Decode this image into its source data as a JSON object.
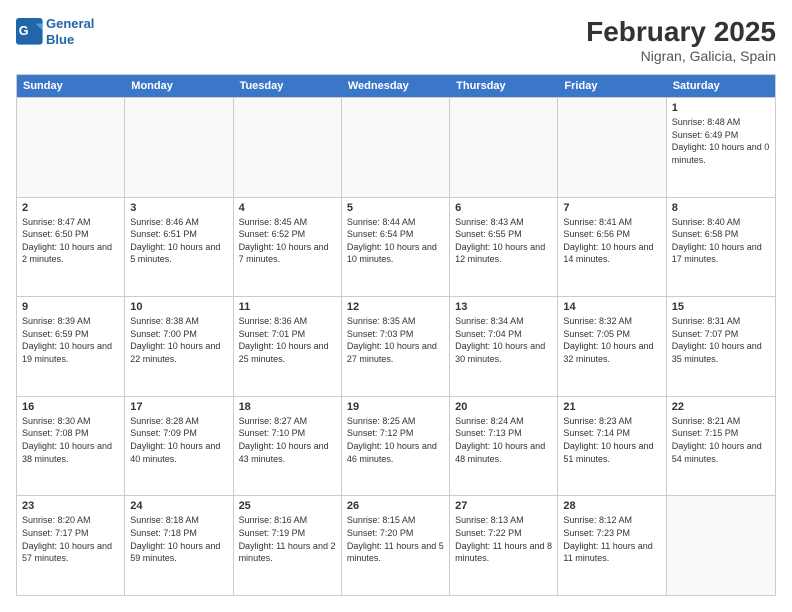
{
  "header": {
    "logo_general": "General",
    "logo_blue": "Blue",
    "title": "February 2025",
    "subtitle": "Nigran, Galicia, Spain"
  },
  "weekdays": [
    "Sunday",
    "Monday",
    "Tuesday",
    "Wednesday",
    "Thursday",
    "Friday",
    "Saturday"
  ],
  "rows": [
    [
      {
        "day": "",
        "text": ""
      },
      {
        "day": "",
        "text": ""
      },
      {
        "day": "",
        "text": ""
      },
      {
        "day": "",
        "text": ""
      },
      {
        "day": "",
        "text": ""
      },
      {
        "day": "",
        "text": ""
      },
      {
        "day": "1",
        "text": "Sunrise: 8:48 AM\nSunset: 6:49 PM\nDaylight: 10 hours and 0 minutes."
      }
    ],
    [
      {
        "day": "2",
        "text": "Sunrise: 8:47 AM\nSunset: 6:50 PM\nDaylight: 10 hours and 2 minutes."
      },
      {
        "day": "3",
        "text": "Sunrise: 8:46 AM\nSunset: 6:51 PM\nDaylight: 10 hours and 5 minutes."
      },
      {
        "day": "4",
        "text": "Sunrise: 8:45 AM\nSunset: 6:52 PM\nDaylight: 10 hours and 7 minutes."
      },
      {
        "day": "5",
        "text": "Sunrise: 8:44 AM\nSunset: 6:54 PM\nDaylight: 10 hours and 10 minutes."
      },
      {
        "day": "6",
        "text": "Sunrise: 8:43 AM\nSunset: 6:55 PM\nDaylight: 10 hours and 12 minutes."
      },
      {
        "day": "7",
        "text": "Sunrise: 8:41 AM\nSunset: 6:56 PM\nDaylight: 10 hours and 14 minutes."
      },
      {
        "day": "8",
        "text": "Sunrise: 8:40 AM\nSunset: 6:58 PM\nDaylight: 10 hours and 17 minutes."
      }
    ],
    [
      {
        "day": "9",
        "text": "Sunrise: 8:39 AM\nSunset: 6:59 PM\nDaylight: 10 hours and 19 minutes."
      },
      {
        "day": "10",
        "text": "Sunrise: 8:38 AM\nSunset: 7:00 PM\nDaylight: 10 hours and 22 minutes."
      },
      {
        "day": "11",
        "text": "Sunrise: 8:36 AM\nSunset: 7:01 PM\nDaylight: 10 hours and 25 minutes."
      },
      {
        "day": "12",
        "text": "Sunrise: 8:35 AM\nSunset: 7:03 PM\nDaylight: 10 hours and 27 minutes."
      },
      {
        "day": "13",
        "text": "Sunrise: 8:34 AM\nSunset: 7:04 PM\nDaylight: 10 hours and 30 minutes."
      },
      {
        "day": "14",
        "text": "Sunrise: 8:32 AM\nSunset: 7:05 PM\nDaylight: 10 hours and 32 minutes."
      },
      {
        "day": "15",
        "text": "Sunrise: 8:31 AM\nSunset: 7:07 PM\nDaylight: 10 hours and 35 minutes."
      }
    ],
    [
      {
        "day": "16",
        "text": "Sunrise: 8:30 AM\nSunset: 7:08 PM\nDaylight: 10 hours and 38 minutes."
      },
      {
        "day": "17",
        "text": "Sunrise: 8:28 AM\nSunset: 7:09 PM\nDaylight: 10 hours and 40 minutes."
      },
      {
        "day": "18",
        "text": "Sunrise: 8:27 AM\nSunset: 7:10 PM\nDaylight: 10 hours and 43 minutes."
      },
      {
        "day": "19",
        "text": "Sunrise: 8:25 AM\nSunset: 7:12 PM\nDaylight: 10 hours and 46 minutes."
      },
      {
        "day": "20",
        "text": "Sunrise: 8:24 AM\nSunset: 7:13 PM\nDaylight: 10 hours and 48 minutes."
      },
      {
        "day": "21",
        "text": "Sunrise: 8:23 AM\nSunset: 7:14 PM\nDaylight: 10 hours and 51 minutes."
      },
      {
        "day": "22",
        "text": "Sunrise: 8:21 AM\nSunset: 7:15 PM\nDaylight: 10 hours and 54 minutes."
      }
    ],
    [
      {
        "day": "23",
        "text": "Sunrise: 8:20 AM\nSunset: 7:17 PM\nDaylight: 10 hours and 57 minutes."
      },
      {
        "day": "24",
        "text": "Sunrise: 8:18 AM\nSunset: 7:18 PM\nDaylight: 10 hours and 59 minutes."
      },
      {
        "day": "25",
        "text": "Sunrise: 8:16 AM\nSunset: 7:19 PM\nDaylight: 11 hours and 2 minutes."
      },
      {
        "day": "26",
        "text": "Sunrise: 8:15 AM\nSunset: 7:20 PM\nDaylight: 11 hours and 5 minutes."
      },
      {
        "day": "27",
        "text": "Sunrise: 8:13 AM\nSunset: 7:22 PM\nDaylight: 11 hours and 8 minutes."
      },
      {
        "day": "28",
        "text": "Sunrise: 8:12 AM\nSunset: 7:23 PM\nDaylight: 11 hours and 11 minutes."
      },
      {
        "day": "",
        "text": ""
      }
    ]
  ]
}
